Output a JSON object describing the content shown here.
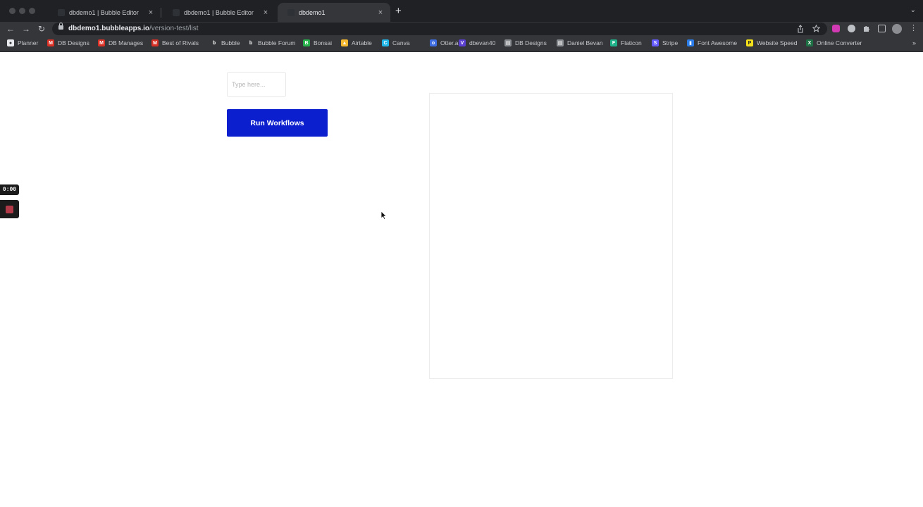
{
  "browser": {
    "tabs": [
      {
        "title": "dbdemo1 | Bubble Editor",
        "close": "×"
      },
      {
        "title": "dbdemo1 | Bubble Editor",
        "close": "×"
      },
      {
        "title": "dbdemo1",
        "close": "×"
      }
    ],
    "new_tab": "+",
    "tab_menu": "⌄",
    "toolbar": {
      "back": "←",
      "forward": "→",
      "reload": "↻"
    },
    "address": {
      "host": "dbdemo1.bubbleapps.io",
      "path": "/version-test/list"
    },
    "bookmarks": [
      {
        "label": "Planner",
        "icon": "planner-icon",
        "color": "#e8eaed"
      },
      {
        "label": "DB Designs",
        "icon": "gmail-icon",
        "color": "#d93025"
      },
      {
        "label": "DB Manages",
        "icon": "gmail-icon",
        "color": "#d93025"
      },
      {
        "label": "Best of Rivals",
        "icon": "gmail-icon",
        "color": "#d93025"
      },
      {
        "label": "Bubble",
        "icon": "bubble-icon",
        "color": "#35363a"
      },
      {
        "label": "Bubble Forum",
        "icon": "bubble-icon",
        "color": "#35363a"
      },
      {
        "label": "Bonsai",
        "icon": "bonsai-icon",
        "color": "#25b04a"
      },
      {
        "label": "Airtable",
        "icon": "airtable-icon",
        "color": "#f5b82e"
      },
      {
        "label": "Canva",
        "icon": "canva-icon",
        "color": "#20b6e8"
      },
      {
        "label": "Otter.ai",
        "icon": "otter-icon",
        "color": "#3d6de0"
      },
      {
        "label": "dbevan40",
        "icon": "vimeo-icon",
        "color": "#5b3fd1"
      },
      {
        "label": "DB Designs",
        "icon": "page-icon",
        "color": "#8a8d91"
      },
      {
        "label": "Daniel Bevan",
        "icon": "page-icon",
        "color": "#8a8d91"
      },
      {
        "label": "Flaticon",
        "icon": "flaticon-icon",
        "color": "#1fb28a"
      },
      {
        "label": "Stripe",
        "icon": "stripe-icon",
        "color": "#635bff"
      },
      {
        "label": "Font Awesome",
        "icon": "flag-icon",
        "color": "#2b7de9"
      },
      {
        "label": "Website Speed",
        "icon": "pingdom-icon",
        "color": "#f4e01a"
      },
      {
        "label": "Online Converter",
        "icon": "excel-icon",
        "color": "#1e7145"
      }
    ],
    "bookmarks_more": "»"
  },
  "page": {
    "input_placeholder": "Type here...",
    "run_button_label": "Run Workflows"
  },
  "recorder": {
    "time": "0:00"
  }
}
